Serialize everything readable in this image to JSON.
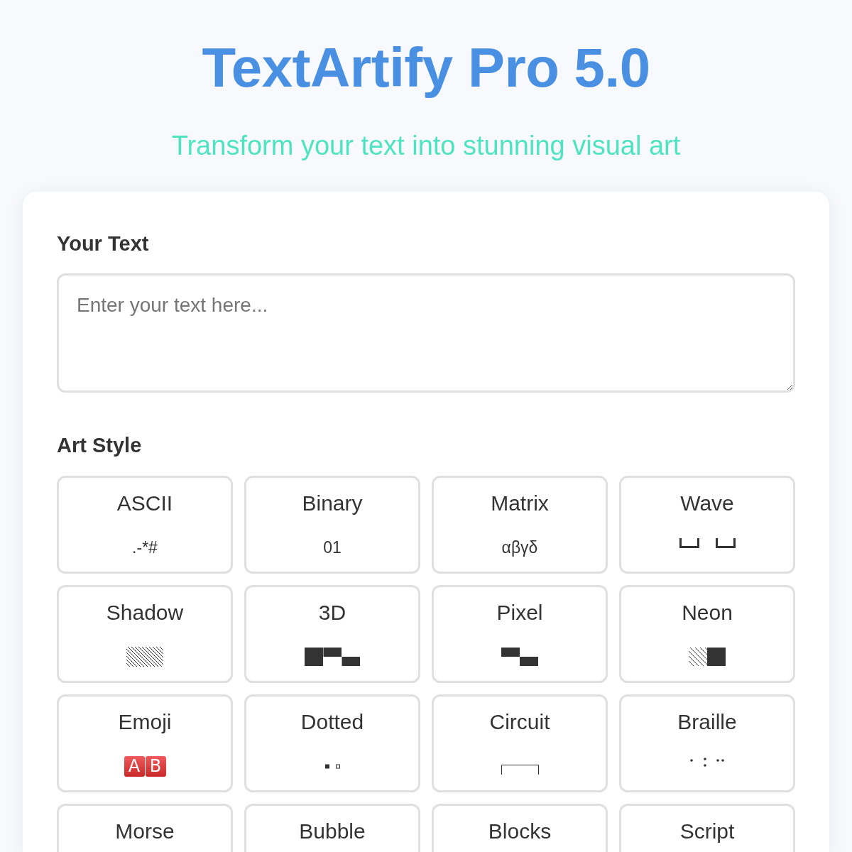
{
  "header": {
    "title": "TextArtify Pro 5.0",
    "subtitle": "Transform your text into stunning visual art"
  },
  "text_input": {
    "label": "Your Text",
    "placeholder": "Enter your text here..."
  },
  "art_style": {
    "label": "Art Style",
    "styles": [
      {
        "label": "ASCII",
        "selected": false,
        "kind": "text",
        "sample": ".-*#"
      },
      {
        "label": "Binary",
        "selected": false,
        "kind": "text",
        "sample": "01"
      },
      {
        "label": "Matrix",
        "selected": false,
        "kind": "text",
        "sample": "αβγδ"
      },
      {
        "label": "Wave",
        "selected": false,
        "kind": "brackets"
      },
      {
        "label": "Shadow",
        "selected": false,
        "kind": "hatch"
      },
      {
        "label": "3D",
        "selected": false,
        "kind": "steps"
      },
      {
        "label": "Pixel",
        "selected": false,
        "kind": "pixels"
      },
      {
        "label": "Neon",
        "selected": false,
        "kind": "neon"
      },
      {
        "label": "Emoji",
        "selected": false,
        "kind": "tiles",
        "letters": [
          "A",
          "B"
        ]
      },
      {
        "label": "Dotted",
        "selected": false,
        "kind": "squares"
      },
      {
        "label": "Circuit",
        "selected": false,
        "kind": "frame"
      },
      {
        "label": "Braille",
        "selected": false,
        "kind": "braille"
      },
      {
        "label": "Morse",
        "selected": false
      },
      {
        "label": "Bubble",
        "selected": false
      },
      {
        "label": "Blocks",
        "selected": false
      },
      {
        "label": "Script",
        "selected": false
      }
    ]
  }
}
